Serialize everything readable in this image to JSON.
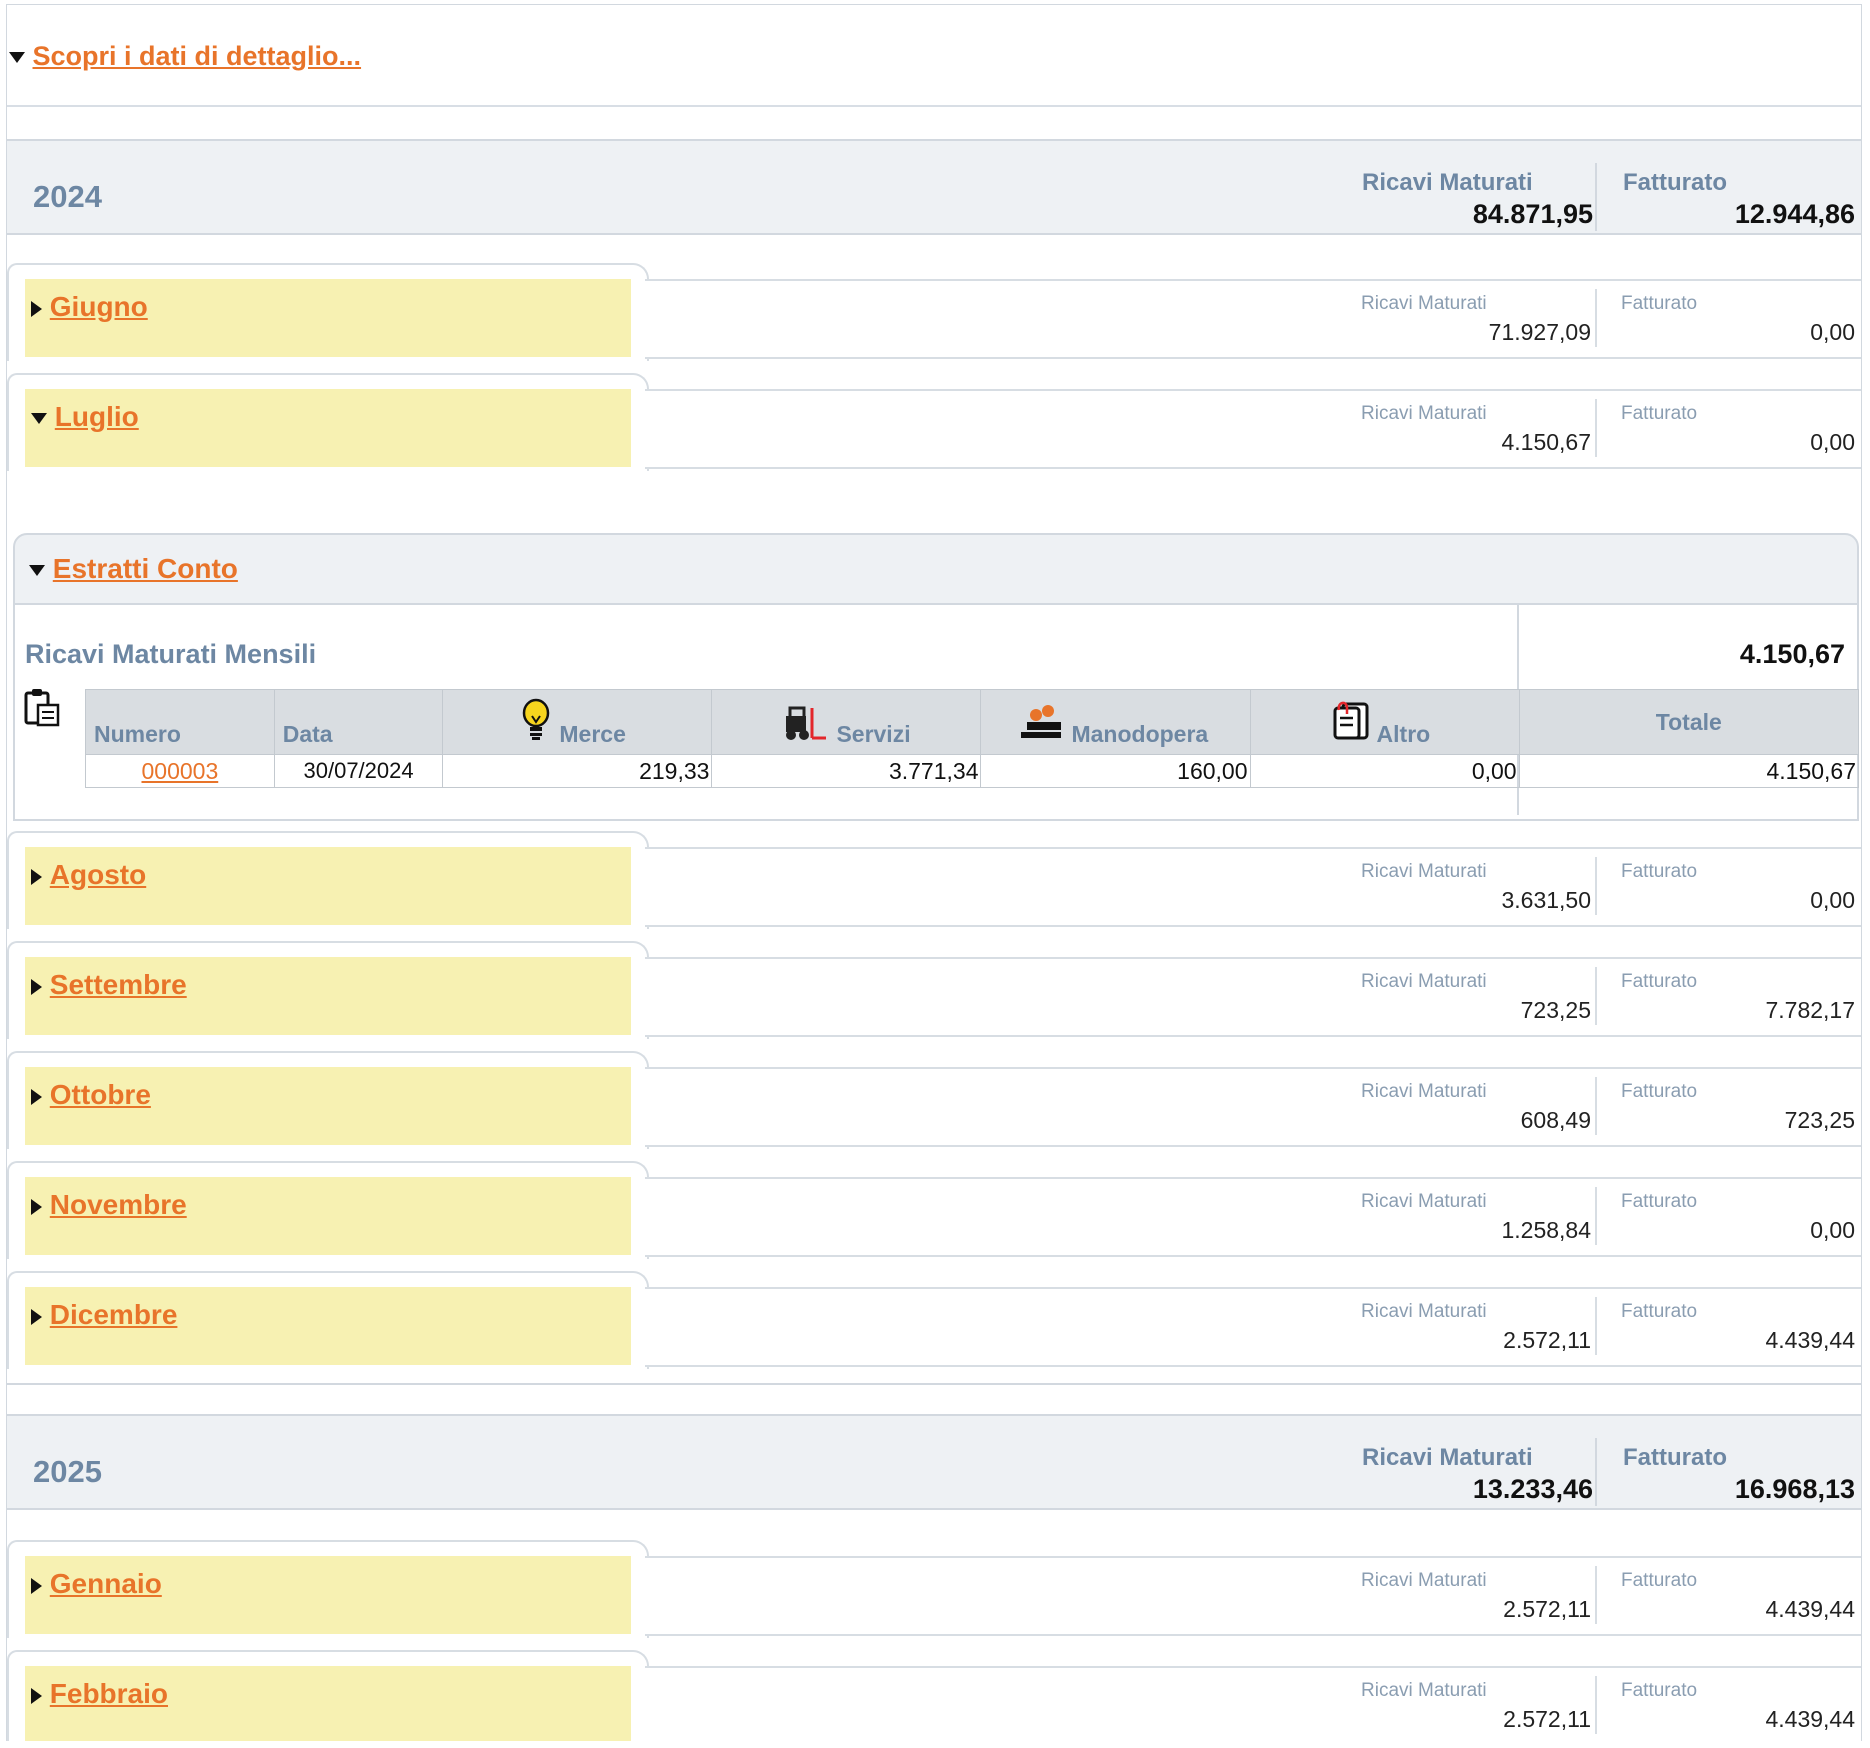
{
  "top": {
    "link_label": "Scopri i dati di dettaglio..."
  },
  "colors": {
    "link": "#e8742a",
    "header_text": "#6d87a3",
    "month_bg": "#f7f1b2"
  },
  "labels": {
    "ricavi": "Ricavi Maturati",
    "fatturato": "Fatturato"
  },
  "years": [
    {
      "year": "2024",
      "ricavi": "84.871,95",
      "fatturato": "12.944,86"
    },
    {
      "year": "2025",
      "ricavi": "13.233,46",
      "fatturato": "16.968,13"
    }
  ],
  "months": [
    {
      "name": "Giugno",
      "ricavi": "71.927,09",
      "fatturato": "0,00",
      "expanded": false
    },
    {
      "name": "Luglio",
      "ricavi": "4.150,67",
      "fatturato": "0,00",
      "expanded": true
    },
    {
      "name": "Agosto",
      "ricavi": "3.631,50",
      "fatturato": "0,00",
      "expanded": false
    },
    {
      "name": "Settembre",
      "ricavi": "723,25",
      "fatturato": "7.782,17",
      "expanded": false
    },
    {
      "name": "Ottobre",
      "ricavi": "608,49",
      "fatturato": "723,25",
      "expanded": false
    },
    {
      "name": "Novembre",
      "ricavi": "1.258,84",
      "fatturato": "0,00",
      "expanded": false
    },
    {
      "name": "Dicembre",
      "ricavi": "2.572,11",
      "fatturato": "4.439,44",
      "expanded": false
    },
    {
      "name": "Gennaio",
      "ricavi": "2.572,11",
      "fatturato": "4.439,44",
      "expanded": false
    },
    {
      "name": "Febbraio",
      "ricavi": "2.572,11",
      "fatturato": "4.439,44",
      "expanded": false
    }
  ],
  "estratti": {
    "title": "Estratti Conto",
    "section_title": "Ricavi Maturati Mensili",
    "section_total": "4.150,67",
    "columns": {
      "numero": "Numero",
      "data": "Data",
      "merce": "Merce",
      "servizi": "Servizi",
      "manodopera": "Manodopera",
      "altro": "Altro",
      "totale": "Totale"
    },
    "row": {
      "numero": "000003",
      "data": "30/07/2024",
      "merce": "219,33",
      "servizi": "3.771,34",
      "manodopera": "160,00",
      "altro": "0,00",
      "totale": "4.150,67"
    }
  }
}
